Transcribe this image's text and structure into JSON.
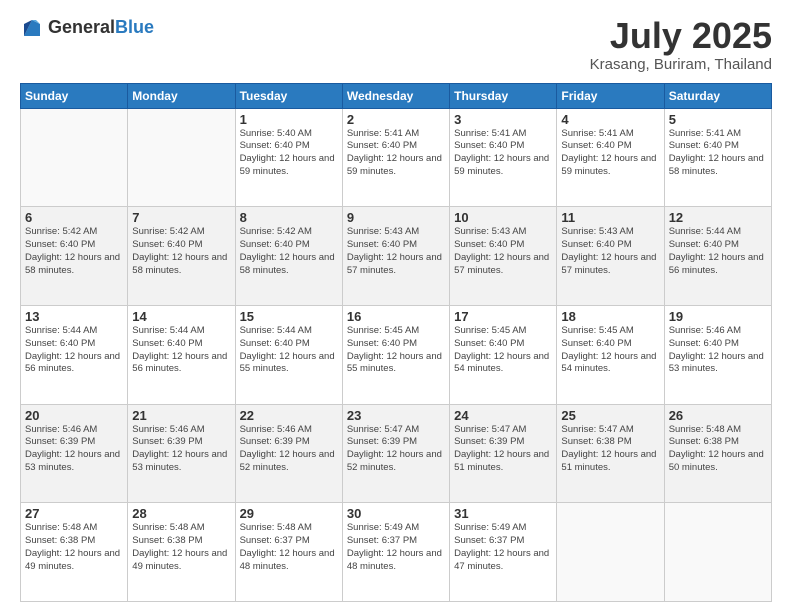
{
  "logo": {
    "general": "General",
    "blue": "Blue"
  },
  "title": {
    "month": "July 2025",
    "location": "Krasang, Buriram, Thailand"
  },
  "headers": [
    "Sunday",
    "Monday",
    "Tuesday",
    "Wednesday",
    "Thursday",
    "Friday",
    "Saturday"
  ],
  "weeks": [
    [
      {
        "day": "",
        "info": ""
      },
      {
        "day": "",
        "info": ""
      },
      {
        "day": "1",
        "info": "Sunrise: 5:40 AM\nSunset: 6:40 PM\nDaylight: 12 hours and 59 minutes."
      },
      {
        "day": "2",
        "info": "Sunrise: 5:41 AM\nSunset: 6:40 PM\nDaylight: 12 hours and 59 minutes."
      },
      {
        "day": "3",
        "info": "Sunrise: 5:41 AM\nSunset: 6:40 PM\nDaylight: 12 hours and 59 minutes."
      },
      {
        "day": "4",
        "info": "Sunrise: 5:41 AM\nSunset: 6:40 PM\nDaylight: 12 hours and 59 minutes."
      },
      {
        "day": "5",
        "info": "Sunrise: 5:41 AM\nSunset: 6:40 PM\nDaylight: 12 hours and 58 minutes."
      }
    ],
    [
      {
        "day": "6",
        "info": "Sunrise: 5:42 AM\nSunset: 6:40 PM\nDaylight: 12 hours and 58 minutes."
      },
      {
        "day": "7",
        "info": "Sunrise: 5:42 AM\nSunset: 6:40 PM\nDaylight: 12 hours and 58 minutes."
      },
      {
        "day": "8",
        "info": "Sunrise: 5:42 AM\nSunset: 6:40 PM\nDaylight: 12 hours and 58 minutes."
      },
      {
        "day": "9",
        "info": "Sunrise: 5:43 AM\nSunset: 6:40 PM\nDaylight: 12 hours and 57 minutes."
      },
      {
        "day": "10",
        "info": "Sunrise: 5:43 AM\nSunset: 6:40 PM\nDaylight: 12 hours and 57 minutes."
      },
      {
        "day": "11",
        "info": "Sunrise: 5:43 AM\nSunset: 6:40 PM\nDaylight: 12 hours and 57 minutes."
      },
      {
        "day": "12",
        "info": "Sunrise: 5:44 AM\nSunset: 6:40 PM\nDaylight: 12 hours and 56 minutes."
      }
    ],
    [
      {
        "day": "13",
        "info": "Sunrise: 5:44 AM\nSunset: 6:40 PM\nDaylight: 12 hours and 56 minutes."
      },
      {
        "day": "14",
        "info": "Sunrise: 5:44 AM\nSunset: 6:40 PM\nDaylight: 12 hours and 56 minutes."
      },
      {
        "day": "15",
        "info": "Sunrise: 5:44 AM\nSunset: 6:40 PM\nDaylight: 12 hours and 55 minutes."
      },
      {
        "day": "16",
        "info": "Sunrise: 5:45 AM\nSunset: 6:40 PM\nDaylight: 12 hours and 55 minutes."
      },
      {
        "day": "17",
        "info": "Sunrise: 5:45 AM\nSunset: 6:40 PM\nDaylight: 12 hours and 54 minutes."
      },
      {
        "day": "18",
        "info": "Sunrise: 5:45 AM\nSunset: 6:40 PM\nDaylight: 12 hours and 54 minutes."
      },
      {
        "day": "19",
        "info": "Sunrise: 5:46 AM\nSunset: 6:40 PM\nDaylight: 12 hours and 53 minutes."
      }
    ],
    [
      {
        "day": "20",
        "info": "Sunrise: 5:46 AM\nSunset: 6:39 PM\nDaylight: 12 hours and 53 minutes."
      },
      {
        "day": "21",
        "info": "Sunrise: 5:46 AM\nSunset: 6:39 PM\nDaylight: 12 hours and 53 minutes."
      },
      {
        "day": "22",
        "info": "Sunrise: 5:46 AM\nSunset: 6:39 PM\nDaylight: 12 hours and 52 minutes."
      },
      {
        "day": "23",
        "info": "Sunrise: 5:47 AM\nSunset: 6:39 PM\nDaylight: 12 hours and 52 minutes."
      },
      {
        "day": "24",
        "info": "Sunrise: 5:47 AM\nSunset: 6:39 PM\nDaylight: 12 hours and 51 minutes."
      },
      {
        "day": "25",
        "info": "Sunrise: 5:47 AM\nSunset: 6:38 PM\nDaylight: 12 hours and 51 minutes."
      },
      {
        "day": "26",
        "info": "Sunrise: 5:48 AM\nSunset: 6:38 PM\nDaylight: 12 hours and 50 minutes."
      }
    ],
    [
      {
        "day": "27",
        "info": "Sunrise: 5:48 AM\nSunset: 6:38 PM\nDaylight: 12 hours and 49 minutes."
      },
      {
        "day": "28",
        "info": "Sunrise: 5:48 AM\nSunset: 6:38 PM\nDaylight: 12 hours and 49 minutes."
      },
      {
        "day": "29",
        "info": "Sunrise: 5:48 AM\nSunset: 6:37 PM\nDaylight: 12 hours and 48 minutes."
      },
      {
        "day": "30",
        "info": "Sunrise: 5:49 AM\nSunset: 6:37 PM\nDaylight: 12 hours and 48 minutes."
      },
      {
        "day": "31",
        "info": "Sunrise: 5:49 AM\nSunset: 6:37 PM\nDaylight: 12 hours and 47 minutes."
      },
      {
        "day": "",
        "info": ""
      },
      {
        "day": "",
        "info": ""
      }
    ]
  ]
}
